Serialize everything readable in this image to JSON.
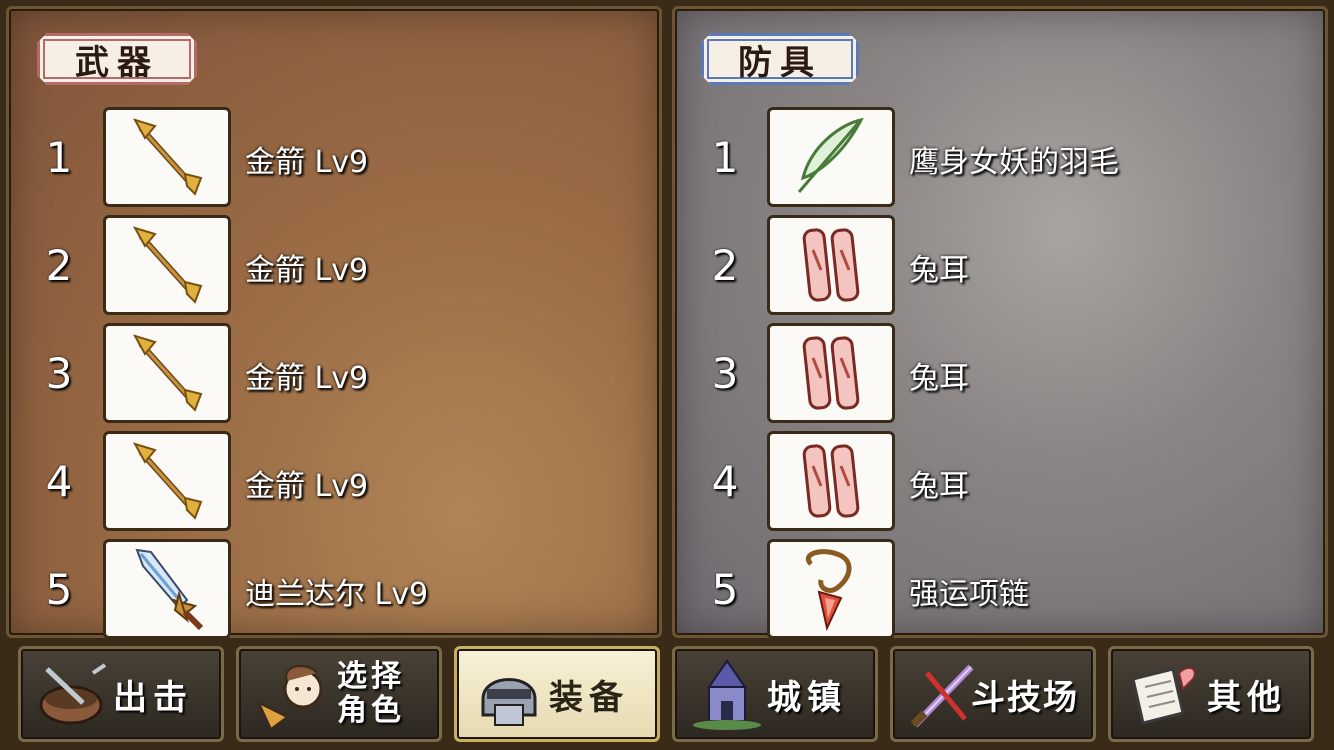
{
  "weapons": {
    "title": "武器",
    "items": [
      {
        "index": "1",
        "name": "金箭 Lv9",
        "icon": "golden-arrow-icon"
      },
      {
        "index": "2",
        "name": "金箭 Lv9",
        "icon": "golden-arrow-icon"
      },
      {
        "index": "3",
        "name": "金箭 Lv9",
        "icon": "golden-arrow-icon"
      },
      {
        "index": "4",
        "name": "金箭 Lv9",
        "icon": "golden-arrow-icon"
      },
      {
        "index": "5",
        "name": "迪兰达尔 Lv9",
        "icon": "durandal-sword-icon"
      }
    ]
  },
  "armor": {
    "title": "防具",
    "items": [
      {
        "index": "1",
        "name": "鹰身女妖的羽毛",
        "icon": "harpy-feather-icon"
      },
      {
        "index": "2",
        "name": "兔耳",
        "icon": "bunny-ears-icon"
      },
      {
        "index": "3",
        "name": "兔耳",
        "icon": "bunny-ears-icon"
      },
      {
        "index": "4",
        "name": "兔耳",
        "icon": "bunny-ears-icon"
      },
      {
        "index": "5",
        "name": "强运项链",
        "icon": "lucky-necklace-icon"
      }
    ]
  },
  "nav": {
    "sortie": {
      "label": "出击",
      "icon": "sortie-bowl-icon"
    },
    "select_character": {
      "line1": "选择",
      "line2": "角色",
      "icon": "character-icon"
    },
    "equipment": {
      "label": "装备",
      "icon": "armor-helmet-icon",
      "active": true
    },
    "town": {
      "label": "城镇",
      "icon": "town-icon"
    },
    "arena": {
      "label": "斗技场",
      "icon": "crossed-swords-icon"
    },
    "other": {
      "label": "其他",
      "icon": "scroll-icon"
    }
  },
  "colors": {
    "weapon_tag_border": "#b56a6a",
    "armor_tag_border": "#5a79b8",
    "active_tab": "#f8f1d8"
  }
}
